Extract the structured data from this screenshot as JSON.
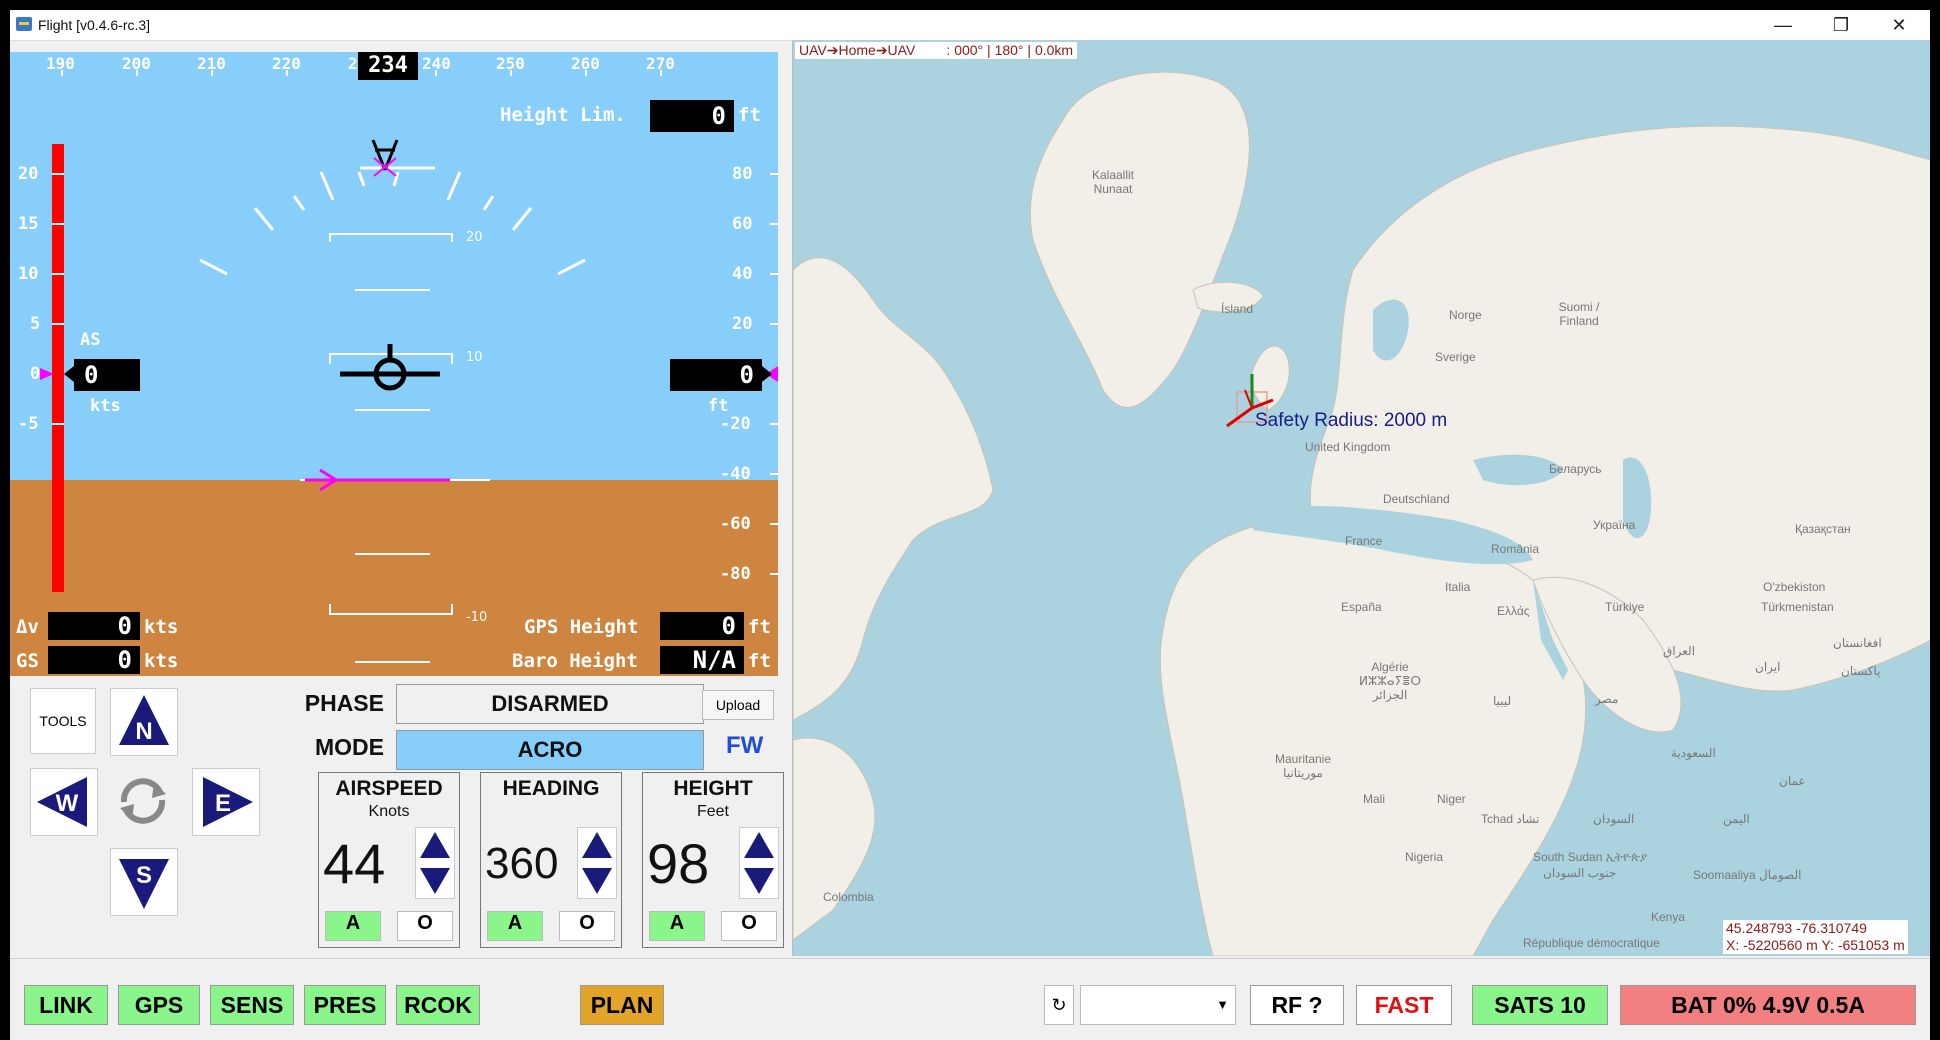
{
  "window": {
    "title": "Flight [v0.4.6-rc.3]",
    "minimize": "—",
    "maximize": "❐",
    "close": "✕"
  },
  "pfd": {
    "heading_ticks": [
      "190",
      "200",
      "210",
      "220",
      "2",
      "240",
      "250",
      "260",
      "270"
    ],
    "heading_value": "234",
    "height_limit_label": "Height Lim.",
    "height_limit_value": "0",
    "height_limit_unit": "ft",
    "speed_ticks": [
      "20",
      "15",
      "10",
      "5",
      "0",
      "-5"
    ],
    "altitude_ticks": [
      "80",
      "60",
      "40",
      "20",
      "-20",
      "-40",
      "-60",
      "-80"
    ],
    "as_label": "AS",
    "airspeed_value": "0",
    "kts_label": "kts",
    "altitude_value": "0",
    "ft_label": "ft",
    "pitch_labels": [
      "20",
      "10",
      "-10"
    ],
    "dv_label": "Δv",
    "dv_value": "0",
    "dv_unit": "kts",
    "gs_label": "GS",
    "gs_value": "0",
    "gs_unit": "kts",
    "gps_height_label": "GPS Height",
    "gps_height_value": "0",
    "gps_height_unit": "ft",
    "baro_height_label": "Baro Height",
    "baro_height_value": "N/A",
    "baro_height_unit": "ft"
  },
  "controls": {
    "tools_label": "TOOLS",
    "directions": {
      "n": "N",
      "w": "W",
      "e": "E",
      "s": "S"
    },
    "phase_label": "PHASE",
    "phase_value": "DISARMED",
    "upload_label": "Upload",
    "mode_label": "MODE",
    "mode_value": "ACRO",
    "frame_type": "FW",
    "panels": [
      {
        "title": "AIRSPEED",
        "unit": "Knots",
        "value": "44",
        "auto": "A",
        "override": "O"
      },
      {
        "title": "HEADING",
        "unit": "",
        "value": "360",
        "auto": "A",
        "override": "O"
      },
      {
        "title": "HEIGHT",
        "unit": "Feet",
        "value": "98",
        "auto": "A",
        "override": "O"
      }
    ]
  },
  "map": {
    "header": "UAV➔Home➔UAV        : 000° | 180° | 0.0km",
    "safety_radius": "Safety Radius: 2000 m",
    "coords_latlon": "45.248793 -76.310749",
    "coords_xy": "X: -5220560 m Y: -651053 m",
    "labels": [
      "Kalaallit Nunaat",
      "Ísland",
      "Norge",
      "Suomi / Finland",
      "Sverige",
      "United Kingdom",
      "Беларусь",
      "Deutschland",
      "France",
      "Україна",
      "Қазақстан",
      "România",
      "España",
      "Italia",
      "Ελλάς",
      "Türkiye",
      "O'zbekiston",
      "Türkmenistan",
      "Algérie ⵍⵣⵣⴰⵢⴻⵔ الجزائر",
      "ليبيا",
      "مصر",
      "العراق",
      "ایران",
      "افغانستان",
      "پاکستان",
      "Mauritanie موريتانيا",
      "Mali",
      "Niger",
      "Tchad تشاد",
      "السودان",
      "السعودية",
      "عمان",
      "اليمن",
      "Nigeria",
      "South Sudan ኢትዮጵያ",
      "جنوب السودان",
      "Soomaaliya الصومال",
      "Colombia",
      "Kenya",
      "République démocratique"
    ]
  },
  "status_bar": {
    "link": "LINK",
    "gps": "GPS",
    "sens": "SENS",
    "pres": "PRES",
    "rcok": "RCOK",
    "plan": "PLAN",
    "refresh_icon": "refresh-icon",
    "dropdown_value": "",
    "rf": "RF ?",
    "fast": "FAST",
    "sats": "SATS 10",
    "battery": "BAT 0% 4.9V 0.5A"
  },
  "colors": {
    "sky": "#87cefa",
    "ground": "#cd853f",
    "magenta": "#ff00ff",
    "ok": "#8af58a",
    "warn": "#e2a52a",
    "alert": "#f28080"
  }
}
